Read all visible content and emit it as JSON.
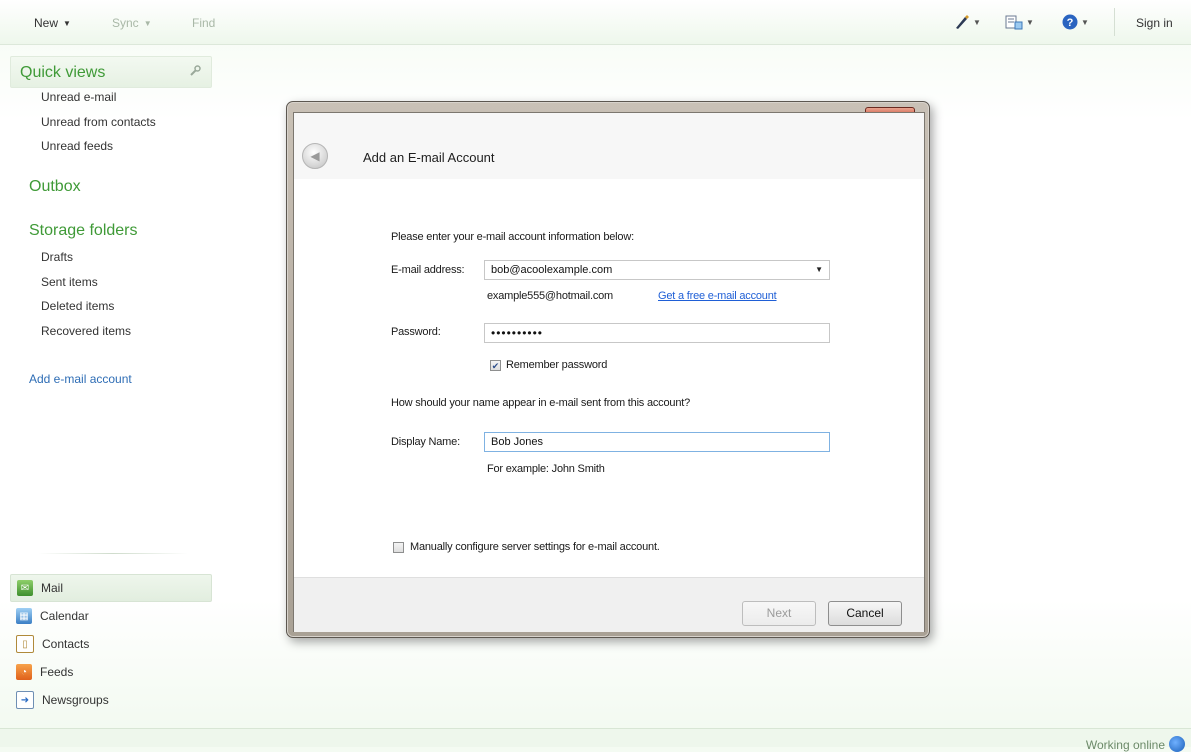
{
  "toolbar": {
    "new_label": "New",
    "sync_label": "Sync",
    "find_label": "Find",
    "signin_label": "Sign in",
    "icons": [
      "pen-icon",
      "layout-icon",
      "help-icon"
    ]
  },
  "sidebar": {
    "quick_views_title": "Quick views",
    "quick_views": [
      "Unread e-mail",
      "Unread from contacts",
      "Unread feeds"
    ],
    "outbox_title": "Outbox",
    "storage_title": "Storage folders",
    "storage_items": [
      "Drafts",
      "Sent items",
      "Deleted items",
      "Recovered items"
    ],
    "add_account_link": "Add e-mail account",
    "nav": [
      {
        "label": "Mail",
        "icon": "mail-icon",
        "selected": true
      },
      {
        "label": "Calendar",
        "icon": "calendar-icon"
      },
      {
        "label": "Contacts",
        "icon": "contacts-icon"
      },
      {
        "label": "Feeds",
        "icon": "feeds-icon"
      },
      {
        "label": "Newsgroups",
        "icon": "newsgroups-icon"
      }
    ]
  },
  "dialog": {
    "title": "Add an E-mail Account",
    "close_label": "x",
    "intro": "Please enter your e-mail account information below:",
    "email_label": "E-mail address:",
    "email_value": "bob@acoolexample.com",
    "email_example": "example555@hotmail.com",
    "free_account_link": "Get a free e-mail account",
    "password_label": "Password:",
    "password_value": "••••••••••",
    "remember_label": "Remember password",
    "remember_checked": true,
    "name_question": "How should your name appear in e-mail sent from this account?",
    "display_name_label": "Display Name:",
    "display_name_value": "Bob Jones",
    "display_name_example": "For example: John Smith",
    "manual_config_label": "Manually configure server settings for e-mail account.",
    "manual_config_checked": false,
    "next_label": "Next",
    "cancel_label": "Cancel"
  },
  "status": {
    "text": "Working online"
  },
  "colors": {
    "accent_green": "#3f9a37",
    "link_blue": "#2e6db5",
    "close_red": "#c9432b"
  }
}
